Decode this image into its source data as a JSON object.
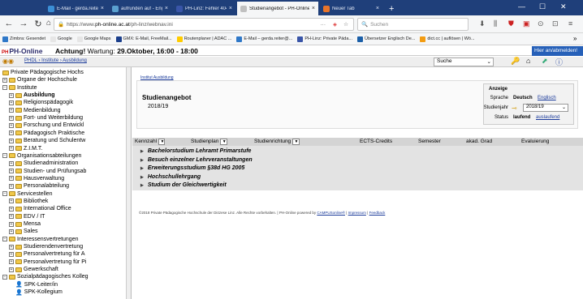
{
  "browser": {
    "tabs": [
      {
        "label": "E-Mail - gerda.reiter@ph-linz.c",
        "color": "#3b8fd6",
        "active": false
      },
      {
        "label": "aufrunden auf - Englisch-Über",
        "color": "#5aa0cf",
        "active": false
      },
      {
        "label": "PH-Linz: Fehler 404: Keine Seite",
        "color": "#3955a8",
        "active": false
      },
      {
        "label": "Studienangebot - PH-Online",
        "color": "#c0c0c0",
        "active": true
      },
      {
        "label": "Neuer Tab",
        "color": "#e8742a",
        "active": false
      }
    ],
    "close_glyph": "×",
    "new_tab": "+",
    "url_prefix": "https://www.",
    "url_domain": "ph-online.ac.at",
    "url_path": "/ph-linz/webnav.ini",
    "url_dots": "···",
    "search_placeholder": "Suchen",
    "bookmarks": [
      {
        "label": "Zimbra: Gesendet",
        "color": "#2f78c8"
      },
      {
        "label": "Google",
        "color": "#e6e6e6"
      },
      {
        "label": "Google Maps",
        "color": "#e6e6e6"
      },
      {
        "label": "GMX: E-Mail, FreeMail...",
        "color": "#1b3f8c"
      },
      {
        "label": "Routenplaner | ADAC ...",
        "color": "#ffcc00"
      },
      {
        "label": "E-Mail – gerda.reiter@...",
        "color": "#2f78c8"
      },
      {
        "label": "PH-Linz: Private Päda...",
        "color": "#3955a8"
      },
      {
        "label": "Übersetzer Englisch De...",
        "color": "#1b5fa8"
      },
      {
        "label": "dict.cc | auflösen | Wö...",
        "color": "#f39c12"
      }
    ],
    "overflow": "»"
  },
  "ph": {
    "logo": "PH-Online",
    "warning_bold": "Achtung!",
    "warning_text": " Wartung: ",
    "warning_date": "29.Oktober, 16:00 - 18:00",
    "login_link": "Hier an/abmelden!",
    "crumb_1": "PHDL",
    "crumb_2": "Institute",
    "crumb_3": "Ausbildung",
    "search_select": "Suche"
  },
  "tree": [
    {
      "label": "Private Pädagogische Hochs",
      "level": 0,
      "pm": "",
      "bold": false,
      "folder": true
    },
    {
      "label": "Organe der Hochschule",
      "level": 0,
      "pm": "+",
      "bold": false,
      "folder": true
    },
    {
      "label": "Institute",
      "level": 0,
      "pm": "−",
      "bold": false,
      "folder": true
    },
    {
      "label": "Ausbildung",
      "level": 1,
      "pm": "+",
      "bold": true,
      "folder": true
    },
    {
      "label": "Religionspädagogik",
      "level": 1,
      "pm": "+",
      "bold": false,
      "folder": true
    },
    {
      "label": "Medienbildung",
      "level": 1,
      "pm": "+",
      "bold": false,
      "folder": true
    },
    {
      "label": "Fort- und Weiterbildung",
      "level": 1,
      "pm": "+",
      "bold": false,
      "folder": true
    },
    {
      "label": "Forschung und Entwickl",
      "level": 1,
      "pm": "+",
      "bold": false,
      "folder": true
    },
    {
      "label": "Pädagogisch Praktische",
      "level": 1,
      "pm": "+",
      "bold": false,
      "folder": true
    },
    {
      "label": "Beratung und Schulentw",
      "level": 1,
      "pm": "+",
      "bold": false,
      "folder": true
    },
    {
      "label": "Z.I.M.T.",
      "level": 1,
      "pm": "+",
      "bold": false,
      "folder": true
    },
    {
      "label": "Organisationsabteilungen",
      "level": 0,
      "pm": "−",
      "bold": false,
      "folder": true
    },
    {
      "label": "Studienadministration",
      "level": 1,
      "pm": "+",
      "bold": false,
      "folder": true
    },
    {
      "label": "Studien- und Prüfungsab",
      "level": 1,
      "pm": "+",
      "bold": false,
      "folder": true
    },
    {
      "label": "Hausverwaltung",
      "level": 1,
      "pm": "+",
      "bold": false,
      "folder": true
    },
    {
      "label": "Personalabteilung",
      "level": 1,
      "pm": "+",
      "bold": false,
      "folder": true
    },
    {
      "label": "Servicestellen",
      "level": 0,
      "pm": "−",
      "bold": false,
      "folder": true
    },
    {
      "label": "Bibliothek",
      "level": 1,
      "pm": "+",
      "bold": false,
      "folder": true
    },
    {
      "label": "International Office",
      "level": 1,
      "pm": "+",
      "bold": false,
      "folder": true
    },
    {
      "label": "EDV / IT",
      "level": 1,
      "pm": "+",
      "bold": false,
      "folder": true
    },
    {
      "label": "Mensa",
      "level": 1,
      "pm": "+",
      "bold": false,
      "folder": true
    },
    {
      "label": "Sales",
      "level": 1,
      "pm": "+",
      "bold": false,
      "folder": true
    },
    {
      "label": "Interessensvertretungen",
      "level": 0,
      "pm": "−",
      "bold": false,
      "folder": true
    },
    {
      "label": "Studierendenvertretung",
      "level": 1,
      "pm": "+",
      "bold": false,
      "folder": true
    },
    {
      "label": "Personalvertretung für A",
      "level": 1,
      "pm": "+",
      "bold": false,
      "folder": true
    },
    {
      "label": "Personalvertretung für Pi",
      "level": 1,
      "pm": "+",
      "bold": false,
      "folder": true
    },
    {
      "label": "Gewerkschaft",
      "level": 1,
      "pm": "+",
      "bold": false,
      "folder": true
    },
    {
      "label": "Sozialpädagogisches Kolleg",
      "level": 0,
      "pm": "−",
      "bold": false,
      "folder": true
    },
    {
      "label": "SPK-Leiter/in",
      "level": 1,
      "pm": "",
      "bold": false,
      "folder": false
    },
    {
      "label": "SPK-Kollegium",
      "level": 1,
      "pm": "",
      "bold": false,
      "folder": false
    }
  ],
  "content": {
    "inst_link": "Institut Ausbildung",
    "title": "Studienangebot",
    "year": "2018/19",
    "anzeige": {
      "header": "Anzeige",
      "sprache_label": "Sprache",
      "sprache_value": "Deutsch",
      "sprache_link": "Englisch",
      "jahr_label": "Studienjahr",
      "jahr_value": "2018/19",
      "status_label": "Status",
      "status_value": "laufend",
      "status_link": "auslaufend"
    },
    "columns": [
      "Kennzahl",
      "Studienplan",
      "Studienrichtung",
      "ECTS-Credits",
      "Semester",
      "akad. Grad",
      "Evaluierung"
    ],
    "programs": [
      "Bachelorstudium Lehramt Primarstufe",
      "Besuch einzelner Lehrveranstaltungen",
      "Erweiterungsstudium §38d HG 2005",
      "Hochschullehrgang",
      "Studium der Gleichwertigkeit"
    ],
    "footer_text": "©2018 Private Pädagogische Hochschule der Diözese Linz. Alle Rechte vorbehalten. | PH-Online powered by ",
    "footer_link1": "CAMPUSonline®",
    "footer_sep": " | ",
    "footer_link2": "Impressum",
    "footer_link3": "Feedback"
  }
}
